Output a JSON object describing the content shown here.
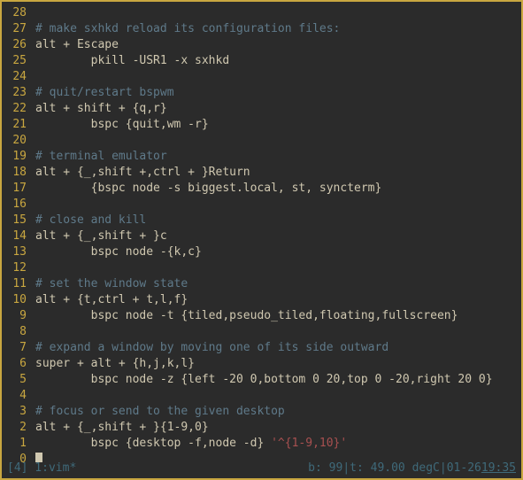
{
  "editor": {
    "lines": [
      {
        "n": "28",
        "segs": []
      },
      {
        "n": "27",
        "segs": [
          {
            "cls": "cmt",
            "t": "# make sxhkd reload its configuration files:"
          }
        ]
      },
      {
        "n": "26",
        "segs": [
          {
            "cls": "kw",
            "t": "alt + Escape"
          }
        ]
      },
      {
        "n": "25",
        "segs": [
          {
            "cls": "kw",
            "t": "        pkill -USR1 -x sxhkd"
          }
        ]
      },
      {
        "n": "24",
        "segs": []
      },
      {
        "n": "23",
        "segs": [
          {
            "cls": "cmt",
            "t": "# quit/restart bspwm"
          }
        ]
      },
      {
        "n": "22",
        "segs": [
          {
            "cls": "kw",
            "t": "alt + shift + {q,r}"
          }
        ]
      },
      {
        "n": "21",
        "segs": [
          {
            "cls": "kw",
            "t": "        bspc {quit,wm -r}"
          }
        ]
      },
      {
        "n": "20",
        "segs": []
      },
      {
        "n": "19",
        "segs": [
          {
            "cls": "cmt",
            "t": "# terminal emulator"
          }
        ]
      },
      {
        "n": "18",
        "segs": [
          {
            "cls": "kw",
            "t": "alt + {_,shift +,ctrl + }Return"
          }
        ]
      },
      {
        "n": "17",
        "segs": [
          {
            "cls": "kw",
            "t": "        {bspc node -s biggest.local, st, syncterm}"
          }
        ]
      },
      {
        "n": "16",
        "segs": []
      },
      {
        "n": "15",
        "segs": [
          {
            "cls": "cmt",
            "t": "# close and kill"
          }
        ]
      },
      {
        "n": "14",
        "segs": [
          {
            "cls": "kw",
            "t": "alt + {_,shift + }c"
          }
        ]
      },
      {
        "n": "13",
        "segs": [
          {
            "cls": "kw",
            "t": "        bspc node -{k,c}"
          }
        ]
      },
      {
        "n": "12",
        "segs": []
      },
      {
        "n": "11",
        "segs": [
          {
            "cls": "cmt",
            "t": "# set the window state"
          }
        ]
      },
      {
        "n": "10",
        "segs": [
          {
            "cls": "kw",
            "t": "alt + {t,ctrl + t,l,f}"
          }
        ]
      },
      {
        "n": "9",
        "segs": [
          {
            "cls": "kw",
            "t": "        bspc node -t {tiled,pseudo_tiled,floating,fullscreen}"
          }
        ]
      },
      {
        "n": "8",
        "segs": []
      },
      {
        "n": "7",
        "segs": [
          {
            "cls": "cmt",
            "t": "# expand a window by moving one of its side outward"
          }
        ]
      },
      {
        "n": "6",
        "segs": [
          {
            "cls": "kw",
            "t": "super + alt + {h,j,k,l}"
          }
        ]
      },
      {
        "n": "5",
        "segs": [
          {
            "cls": "kw",
            "t": "        bspc node -z {left -20 0,bottom 0 20,top 0 -20,right 20 0}"
          }
        ]
      },
      {
        "n": "4",
        "segs": []
      },
      {
        "n": "3",
        "segs": [
          {
            "cls": "cmt",
            "t": "# focus or send to the given desktop"
          }
        ]
      },
      {
        "n": "2",
        "segs": [
          {
            "cls": "kw",
            "t": "alt + {_,shift + }{1-9,0}"
          }
        ]
      },
      {
        "n": "1",
        "segs": [
          {
            "cls": "kw",
            "t": "        bspc {desktop -f,node -d} "
          },
          {
            "cls": "str",
            "t": "'^{1-9,10}'"
          }
        ]
      },
      {
        "n": "0",
        "cursor": true,
        "segs": []
      }
    ]
  },
  "status": {
    "left": "[4] 1:vim*",
    "right_battery": "b: 99",
    "right_sep1": " | ",
    "right_temp": "t: 49.00 degC",
    "right_sep2": " | ",
    "right_time_a": "01-26",
    "right_time_b": "19:35"
  }
}
